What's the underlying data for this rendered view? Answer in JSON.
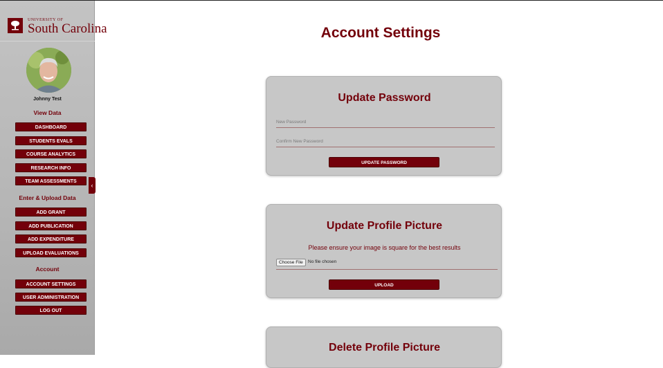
{
  "brand": {
    "small": "UNIVERSITY OF",
    "name": "South Carolina",
    "accent": "#73000a"
  },
  "user": {
    "name": "Johnny Test"
  },
  "sidebar": {
    "view_heading": "View Data",
    "view_items": [
      "DASHBOARD",
      "STUDENTS EVALS",
      "COURSE ANALYTICS",
      "RESEARCH INFO",
      "TEAM ASSESSMENTS"
    ],
    "upload_heading": "Enter & Upload Data",
    "upload_items": [
      "ADD GRANT",
      "ADD PUBLICATION",
      "ADD EXPENDITURE",
      "UPLOAD EVALUATIONS"
    ],
    "account_heading": "Account",
    "account_items": [
      "ACCOUNT SETTINGS",
      "USER ADMINISTRATION",
      "LOG OUT"
    ],
    "collapse_icon": "‹"
  },
  "main": {
    "title": "Account Settings",
    "password_card": {
      "title": "Update Password",
      "new_placeholder": "New Password",
      "confirm_placeholder": "Confirm New Password",
      "button": "UPDATE PASSWORD"
    },
    "picture_card": {
      "title": "Update Profile Picture",
      "note": "Please ensure your image is square for the best results",
      "choose_file": "Choose File",
      "file_status": "No file chosen",
      "button": "UPLOAD"
    },
    "delete_card": {
      "title": "Delete Profile Picture"
    }
  }
}
